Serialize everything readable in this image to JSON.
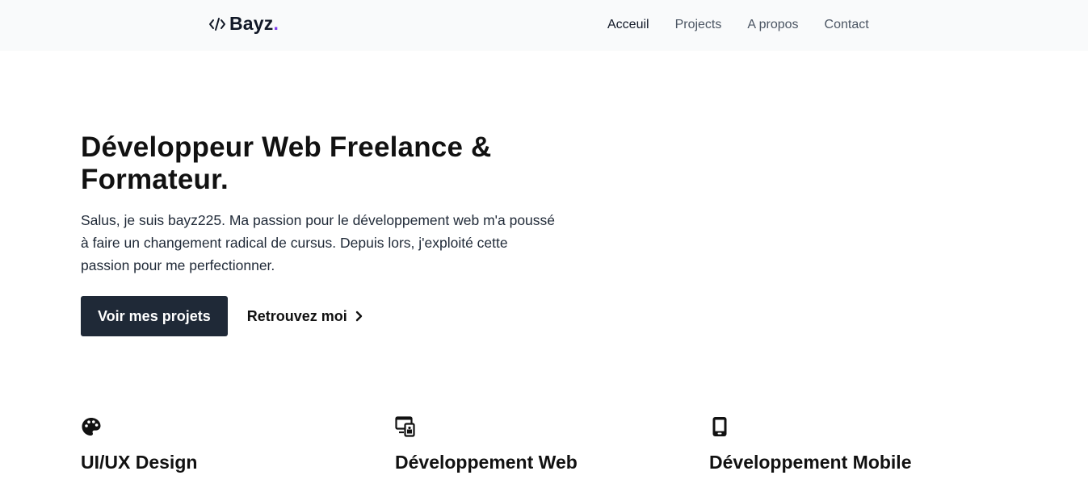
{
  "navbar": {
    "brand": {
      "icon": "code-slash-icon",
      "name": "Bayz",
      "dot": ".",
      "dot_color": "#7c3aed"
    },
    "links": [
      {
        "label": "Acceuil",
        "active": true
      },
      {
        "label": "Projects",
        "active": false
      },
      {
        "label": "A propos",
        "active": false
      },
      {
        "label": "Contact",
        "active": false
      }
    ]
  },
  "hero": {
    "title_line1": "Développeur Web Freelance &",
    "title_line2": "Formateur.",
    "description": "Salus, je suis bayz225. Ma passion pour le développement web m'a poussé à faire un changement radical de cursus. Depuis lors, j'exploité cette passion pour me perfectionner.",
    "primary_button": "Voir mes projets",
    "secondary_link": "Retrouvez moi",
    "secondary_icon": "chevron-right-icon"
  },
  "services": [
    {
      "icon": "palette-icon",
      "title": "UI/UX Design"
    },
    {
      "icon": "devices-icon",
      "title": "Développement Web"
    },
    {
      "icon": "mobile-phone-icon",
      "title": "Développement Mobile"
    }
  ],
  "colors": {
    "navbar_bg": "#f9fafb",
    "primary_button_bg": "#1f2937",
    "text_dark": "#111827"
  }
}
